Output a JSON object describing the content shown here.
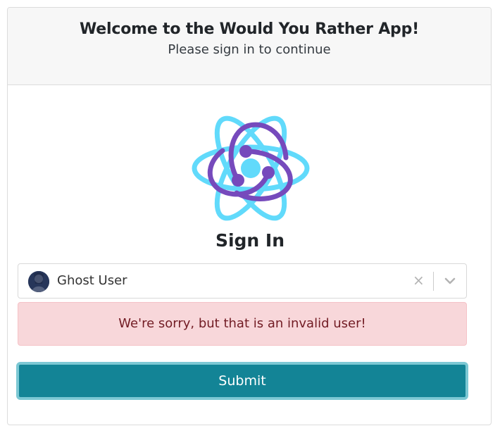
{
  "header": {
    "title": "Welcome to the Would You Rather App!",
    "subtitle": "Please sign in to continue"
  },
  "logo": {
    "icon": "react-redux-logo-icon",
    "colors": {
      "react": "#61dafb",
      "redux": "#764abc"
    }
  },
  "sign_in": {
    "title": "Sign In"
  },
  "user_select": {
    "selected_value": "Ghost User",
    "avatar_icon": "user-avatar",
    "clear_icon": "×",
    "dropdown_icon": "chevron-down-icon"
  },
  "alert": {
    "message": "We're sorry, but that is an invalid user!",
    "background": "#f8d7da",
    "text_color": "#721c24"
  },
  "submit": {
    "label": "Submit",
    "color": "#138496"
  }
}
